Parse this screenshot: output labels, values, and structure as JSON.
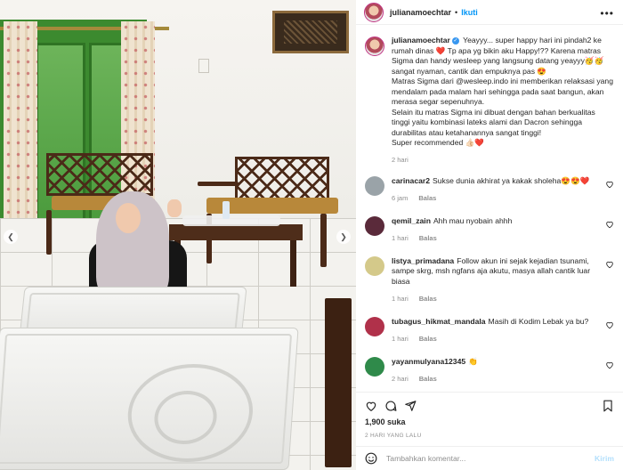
{
  "header": {
    "username": "julianamoechtar",
    "separator": "•",
    "follow_label": "Ikuti",
    "more_icon": "more-horizontal-icon"
  },
  "caption": {
    "username": "julianamoechtar",
    "text": "Yeayyy... super happy hari ini pindah2 ke rumah dinas ❤️ Tp apa yg bikin aku Happy!?? Karena matras Sigma dan handy wesleep yang langsung datang yeayyy🥳🥳 sangat nyaman, cantik dan empuknya pas 😍\nMatras Sigma dari @wesleep.indo ini memberikan relaksasi yang mendalam pada malam hari sehingga pada saat bangun, akan merasa segar sepenuhnya.\nSelain itu matras Sigma ini dibuat dengan bahan berkualitas tinggi yaitu kombinasi lateks alami dan Dacron sehingga durabilitas atau ketahanannya sangat tinggi!\nSuper recommended 👍🏻❤️",
    "time": "2 hari"
  },
  "comments": [
    {
      "username": "carinacar2",
      "text": "Sukse dunia akhirat ya kakak sholeha😍😍❤️",
      "time": "6 jam",
      "reply": "Balas",
      "avatar_color": "#9aa3a8"
    },
    {
      "username": "qemil_zain",
      "text": "Ahh mau nyobain ahhh",
      "time": "1 hari",
      "reply": "Balas",
      "avatar_color": "#5a2a3a"
    },
    {
      "username": "listya_primadana",
      "text": "Follow akun ini sejak kejadian tsunami, sampe skrg, msh ngfans aja akutu, masya allah cantik luar biasa",
      "time": "1 hari",
      "reply": "Balas",
      "avatar_color": "#d4c98a"
    },
    {
      "username": "tubagus_hikmat_mandala",
      "text": "Masih di Kodim Lebak ya bu?",
      "time": "1 hari",
      "reply": "Balas",
      "avatar_color": "#b0314a"
    },
    {
      "username": "yayanmulyana12345",
      "text": "👏",
      "time": "2 hari",
      "reply": "Balas",
      "avatar_color": "#2f8a4a"
    }
  ],
  "likes": "1,900 suka",
  "date": "2 HARI YANG LALU",
  "add_comment": {
    "placeholder": "Tambahkan komentar...",
    "post_label": "Kirim"
  },
  "icons": {
    "heart": "heart-icon",
    "comment": "comment-icon",
    "share": "share-icon",
    "save": "bookmark-icon",
    "emoji": "emoji-icon",
    "prev": "chevron-left-icon",
    "next": "chevron-right-icon"
  },
  "colors": {
    "link": "#0095f6",
    "text": "#262626",
    "muted": "#8e8e8e",
    "post_disabled": "#b2dffc"
  }
}
